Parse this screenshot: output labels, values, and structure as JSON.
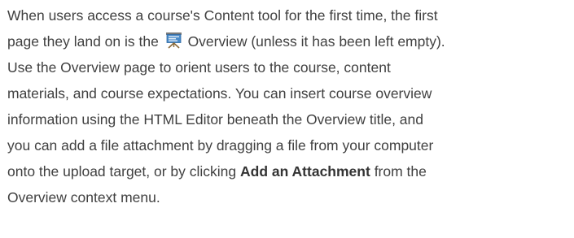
{
  "paragraph": {
    "line1": "When users access a course's Content tool for the first time, the first",
    "line2_pre": "page they land on is the",
    "overview_icon": "overview-presentation-icon",
    "line2_post": "Overview (unless it has been left empty).",
    "line3": "Use the Overview page to orient users to the course, content",
    "line4": "materials, and course expectations. You can insert course overview",
    "line5": "information using the HTML Editor beneath the Overview title, and",
    "line6": "you can add a file attachment by dragging a file from your computer",
    "line7_pre": "onto the upload target, or by clicking",
    "line7_bold": "Add an Attachment",
    "line7_post": "from the",
    "line8": "Overview context menu."
  },
  "colors": {
    "text": "#404040",
    "icon_board": "#4a8bc9",
    "icon_legs": "#8a6a3a"
  }
}
